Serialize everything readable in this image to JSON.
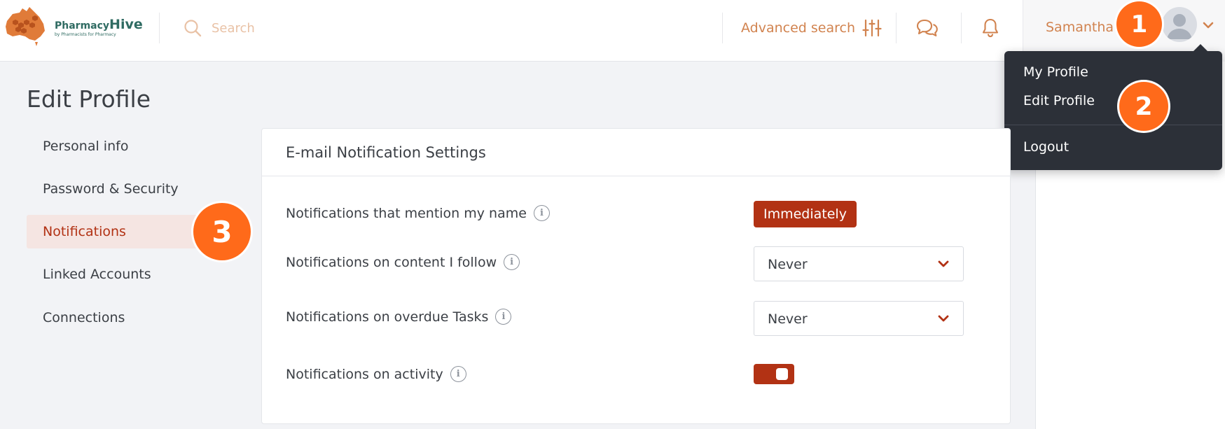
{
  "header": {
    "logo": {
      "name_part1": "Pharmacy",
      "name_part2": "Hive",
      "tagline": "by Pharmacists for Pharmacy",
      "icon": "australia-honeycomb-logo"
    },
    "search": {
      "placeholder": "Search",
      "value": "",
      "icon": "search-icon"
    },
    "advanced_search_label": "Advanced search",
    "messages_icon": "chat-bubbles-icon",
    "notifications_icon": "bell-icon",
    "user_name": "Samantha J",
    "user_icon": "avatar"
  },
  "user_menu": {
    "items": [
      "My Profile",
      "Edit Profile",
      "Logout"
    ]
  },
  "sidebar": {
    "title": "Edit Profile",
    "items": [
      {
        "label": "Personal info",
        "active": false
      },
      {
        "label": "Password & Security",
        "active": false
      },
      {
        "label": "Notifications",
        "active": true
      },
      {
        "label": "Linked Accounts",
        "active": false
      },
      {
        "label": "Connections",
        "active": false
      }
    ]
  },
  "panel": {
    "title": "E-mail Notification Settings",
    "rows": [
      {
        "label": "Notifications that mention my name",
        "control": "badge",
        "value": "Immediately"
      },
      {
        "label": "Notifications on content I follow",
        "control": "select",
        "value": "Never"
      },
      {
        "label": "Notifications on overdue Tasks",
        "control": "select",
        "value": "Never"
      },
      {
        "label": "Notifications on activity",
        "control": "toggle",
        "value": "on"
      }
    ]
  },
  "step_markers": [
    "1",
    "2",
    "3"
  ],
  "colors": {
    "accent": "#b23214",
    "brand_orange": "#d1834f",
    "marker": "#ff6a1a",
    "dropdown_bg": "#2c3038",
    "logo_green": "#2f6b62"
  }
}
